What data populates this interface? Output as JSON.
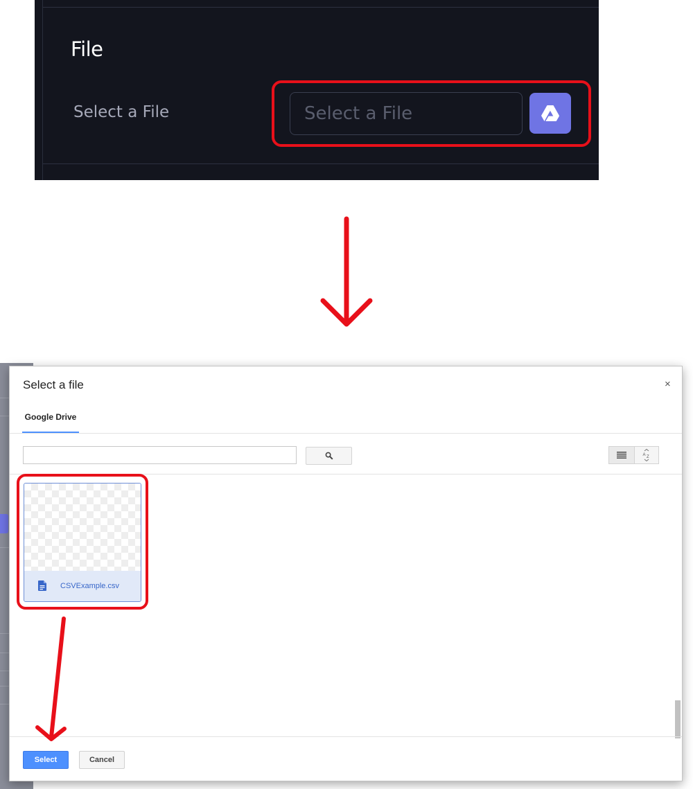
{
  "file_panel": {
    "title": "File",
    "field_label": "Select a File",
    "input_placeholder": "Select a File",
    "drive_button_icon": "google-drive-icon",
    "accent_color": "#6f74e4"
  },
  "annotation": {
    "highlight_color": "#e8101a"
  },
  "picker_dialog": {
    "title": "Select a file",
    "close_label": "×",
    "tabs": [
      {
        "label": "Google Drive",
        "active": true
      }
    ],
    "search": {
      "placeholder": "",
      "button_icon": "search-icon"
    },
    "toolbar_icons": [
      "list-view-icon",
      "sort-az-icon"
    ],
    "files": [
      {
        "name": "CSVExample.csv",
        "icon": "document-icon",
        "selected": true
      }
    ],
    "buttons": {
      "select": "Select",
      "cancel": "Cancel"
    },
    "accent_color": "#4d90fe"
  }
}
